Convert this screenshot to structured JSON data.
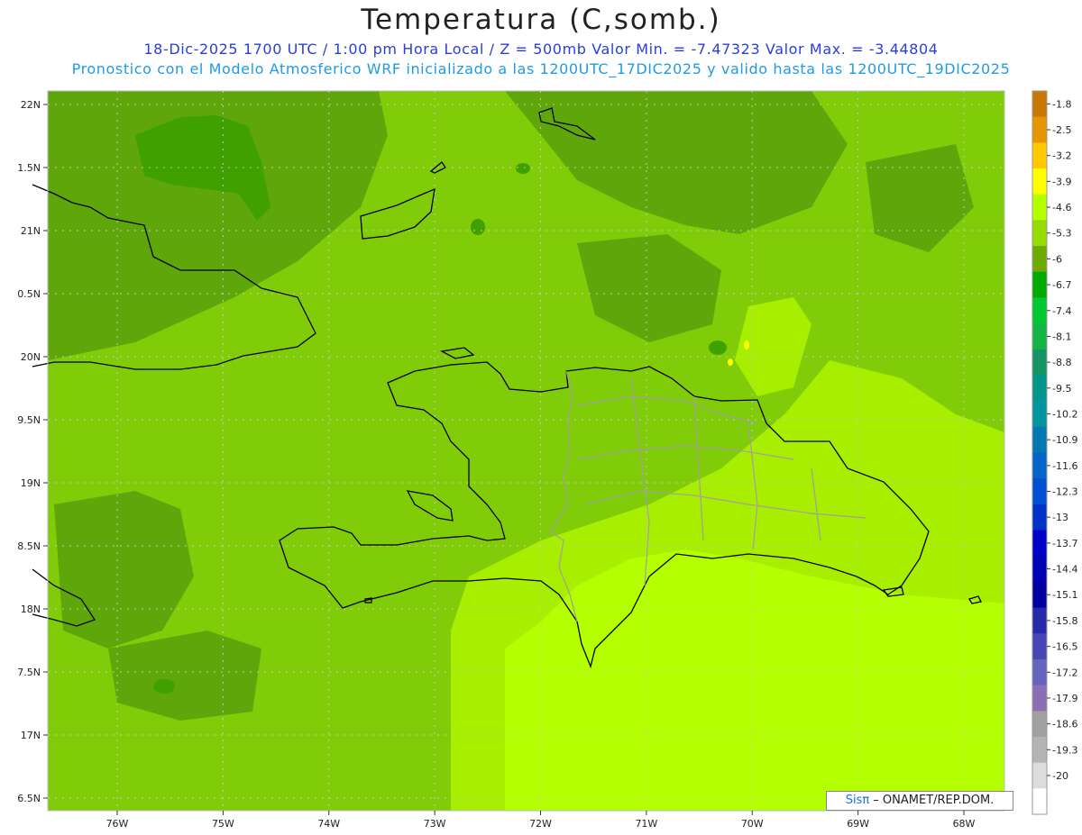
{
  "header": {
    "title": "Temperatura (C,somb.)",
    "line1": "18-Dic-2025   1700 UTC / 1:00 pm Hora Local / Z = 500mb  Valor Min. = -7.47323  Valor Max. = -3.44804",
    "line2": "Pronostico con el Modelo Atmosferico WRF inicializado a las 1200UTC_17DIC2025 y valido hasta las  1200UTC_19DIC2025"
  },
  "map": {
    "lat_labels": [
      "22N",
      "1.5N",
      "21N",
      "0.5N",
      "20N",
      "9.5N",
      "19N",
      "8.5N",
      "18N",
      "7.5N",
      "17N",
      "6.5N"
    ],
    "lon_labels": [
      "76W",
      "75W",
      "74W",
      "73W",
      "72W",
      "71W",
      "70W",
      "69W",
      "68W"
    ],
    "colors": {
      "dark_green": "#5ea60a",
      "mid_green": "#80cc08",
      "light_green": "#a8ee00",
      "yellow_green": "#b4ff00"
    }
  },
  "colorbar": {
    "labels": [
      "-1.8",
      "-2.5",
      "-3.2",
      "-3.9",
      "-4.6",
      "-5.3",
      "-6",
      "-6.7",
      "-7.4",
      "-8.1",
      "-8.8",
      "-9.5",
      "-10.2",
      "-10.9",
      "-11.6",
      "-12.3",
      "-13",
      "-13.7",
      "-14.4",
      "-15.1",
      "-15.8",
      "-16.5",
      "-17.2",
      "-17.9",
      "-18.6",
      "-19.3",
      "-20"
    ],
    "colors": [
      "#c87800",
      "#e69600",
      "#ffc800",
      "#ffff00",
      "#b4ff00",
      "#96dc00",
      "#6eaa00",
      "#00aa00",
      "#00c832",
      "#14b446",
      "#149664",
      "#00968c",
      "#0096a0",
      "#0078b4",
      "#0064c8",
      "#0050d2",
      "#0032c8",
      "#0000c8",
      "#0000b4",
      "#0000a0",
      "#2828aa",
      "#4646b4",
      "#6464be",
      "#8c6eb4",
      "#a0a0a0",
      "#b4b4b4",
      "#dcdcdc"
    ],
    "bottom_color": "#ffffff"
  },
  "credit": {
    "prefix": "Sis",
    "pi": "π",
    "suffix": " – ONAMET/REP.DOM."
  }
}
